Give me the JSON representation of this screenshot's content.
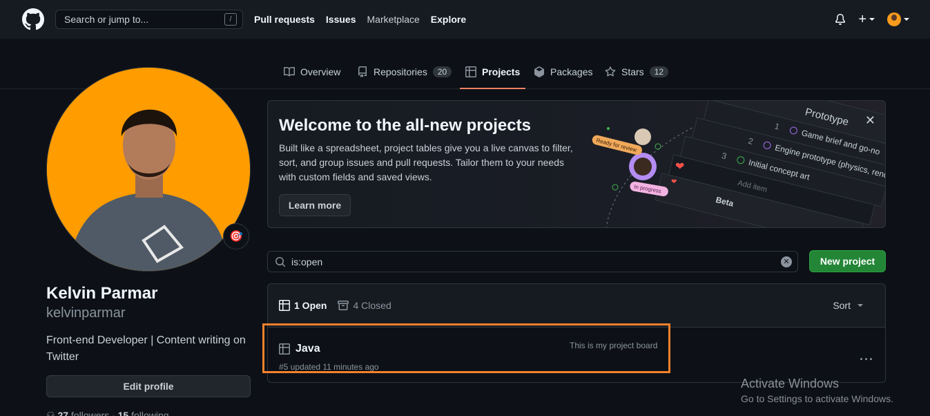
{
  "header": {
    "search_placeholder": "Search or jump to...",
    "search_shortcut": "/",
    "nav": [
      "Pull requests",
      "Issues",
      "Marketplace",
      "Explore"
    ],
    "icons": [
      "github-logo",
      "bell-icon",
      "plus-icon",
      "avatar"
    ]
  },
  "tabs": [
    {
      "label": "Overview",
      "icon": "book-icon"
    },
    {
      "label": "Repositories",
      "icon": "repo-icon",
      "count": "20"
    },
    {
      "label": "Projects",
      "icon": "table-icon",
      "active": true
    },
    {
      "label": "Packages",
      "icon": "package-icon"
    },
    {
      "label": "Stars",
      "icon": "star-icon",
      "count": "12"
    }
  ],
  "profile": {
    "name": "Kelvin Parmar",
    "login": "kelvinparmar",
    "bio": "Front-end Developer | Content writing on Twitter",
    "edit_label": "Edit profile",
    "status_emoji": "🎯",
    "followers_count": "27",
    "followers_label": "followers",
    "following_count": "15",
    "following_label": "following"
  },
  "banner": {
    "title": "Welcome to the all-new projects",
    "body": "Built like a spreadsheet, project tables give you a live canvas to filter, sort, and group issues and pull requests. Tailor them to your needs with custom fields and saved views.",
    "button": "Learn more",
    "illustration": {
      "ready": "Ready for review",
      "progress": "In progress",
      "rows": [
        "Prototype",
        "Game brief and go-no",
        "Engine prototype (physics, renderin",
        "Initial concept art",
        "Add item",
        "Beta"
      ],
      "nums": [
        "1",
        "2",
        "3"
      ]
    }
  },
  "filter": {
    "value": "is:open"
  },
  "new_project_label": "New project",
  "list": {
    "open_label": "1 Open",
    "closed_label": "4 Closed",
    "sort_label": "Sort",
    "projects": [
      {
        "title": "Java",
        "meta": "#5 updated 11 minutes ago",
        "description": "This is my project board"
      }
    ]
  },
  "watermark": {
    "line1": "Activate Windows",
    "line2": "Go to Settings to activate Windows."
  },
  "colors": {
    "accent_tab": "#f78166",
    "primary_button": "#238636",
    "highlight": "#f4812c",
    "avatar_bg": "#ff9c00"
  }
}
